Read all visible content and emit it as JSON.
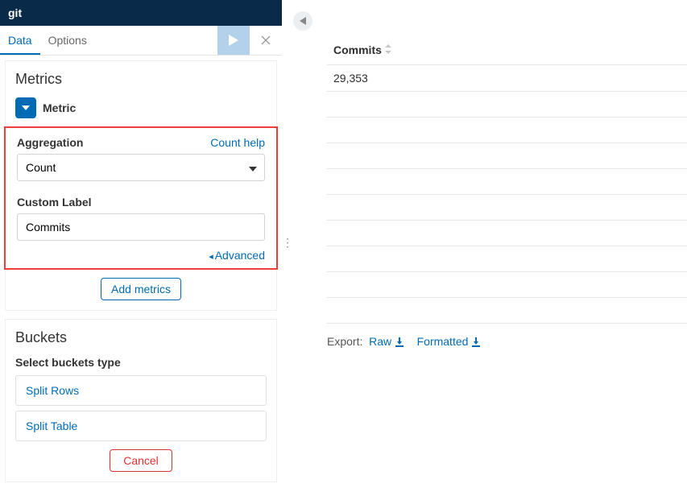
{
  "titlebar": {
    "title": "git"
  },
  "tabs": {
    "data": "Data",
    "options": "Options"
  },
  "metrics": {
    "heading": "Metrics",
    "metric_label": "Metric",
    "aggregation_label": "Aggregation",
    "count_help": "Count help",
    "aggregation_value": "Count",
    "custom_label_label": "Custom Label",
    "custom_label_value": "Commits",
    "advanced": "Advanced",
    "add_metrics": "Add metrics"
  },
  "buckets": {
    "heading": "Buckets",
    "select_label": "Select buckets type",
    "options": [
      "Split Rows",
      "Split Table"
    ],
    "cancel": "Cancel"
  },
  "results": {
    "column_header": "Commits",
    "rows": [
      "29,353",
      "",
      "",
      "",
      "",
      "",
      "",
      "",
      "",
      ""
    ]
  },
  "export": {
    "label": "Export:",
    "raw": "Raw",
    "formatted": "Formatted"
  },
  "chart_data": {
    "type": "table",
    "columns": [
      "Commits"
    ],
    "rows": [
      [
        29353
      ]
    ]
  }
}
